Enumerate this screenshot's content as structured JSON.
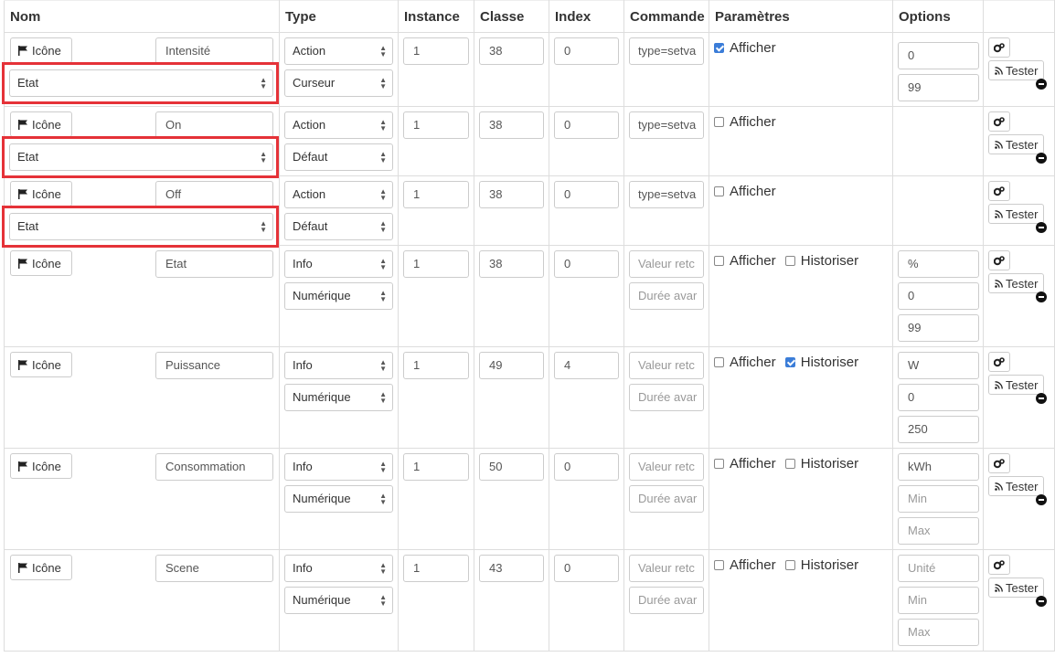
{
  "headers": {
    "nom": "Nom",
    "type": "Type",
    "instance": "Instance",
    "classe": "Classe",
    "index": "Index",
    "commande": "Commande",
    "parametres": "Paramètres",
    "options": "Options"
  },
  "labels": {
    "icone": "Icône",
    "tester": "Tester",
    "afficher": "Afficher",
    "historiser": "Historiser"
  },
  "rows": [
    {
      "name": "Intensité",
      "etat": "Etat",
      "type": "Action",
      "subtype": "Curseur",
      "instance": "1",
      "classe": "38",
      "index": "0",
      "commande": "type=setva",
      "afficher": true,
      "options": [
        "0",
        "99"
      ]
    },
    {
      "name": "On",
      "etat": "Etat",
      "type": "Action",
      "subtype": "Défaut",
      "instance": "1",
      "classe": "38",
      "index": "0",
      "commande": "type=setva",
      "afficher": false
    },
    {
      "name": "Off",
      "etat": "Etat",
      "type": "Action",
      "subtype": "Défaut",
      "instance": "1",
      "classe": "38",
      "index": "0",
      "commande": "type=setva",
      "afficher": false
    },
    {
      "name": "Etat",
      "type": "Info",
      "subtype": "Numérique",
      "instance": "1",
      "classe": "38",
      "index": "0",
      "cmd_ph1": "Valeur retc",
      "cmd_ph2": "Durée avar",
      "afficher": false,
      "historiser": false,
      "options": [
        "%",
        "0",
        "99"
      ]
    },
    {
      "name": "Puissance",
      "type": "Info",
      "subtype": "Numérique",
      "instance": "1",
      "classe": "49",
      "index": "4",
      "cmd_ph1": "Valeur retc",
      "cmd_ph2": "Durée avar",
      "afficher": false,
      "historiser": true,
      "options": [
        "W",
        "0",
        "250"
      ]
    },
    {
      "name": "Consommation",
      "type": "Info",
      "subtype": "Numérique",
      "instance": "1",
      "classe": "50",
      "index": "0",
      "cmd_ph1": "Valeur retc",
      "cmd_ph2": "Durée avar",
      "afficher": false,
      "historiser": false,
      "options": [
        "kWh"
      ],
      "option_ph": [
        "Min",
        "Max"
      ]
    },
    {
      "name": "Scene",
      "type": "Info",
      "subtype": "Numérique",
      "instance": "1",
      "classe": "43",
      "index": "0",
      "cmd_ph1": "Valeur retc",
      "cmd_ph2": "Durée avar",
      "afficher": false,
      "historiser": false,
      "option_ph": [
        "Unité",
        "Min",
        "Max"
      ]
    }
  ]
}
